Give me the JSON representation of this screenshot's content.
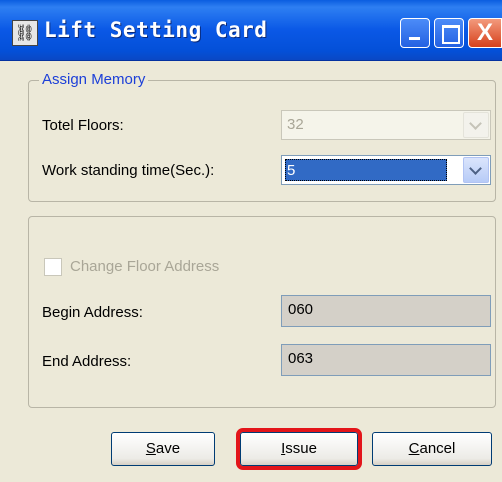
{
  "window": {
    "title": "Lift Setting Card",
    "icon": "lift-app-icon"
  },
  "titlebar_buttons": {
    "minimize_icon": "minimize-icon",
    "maximize_icon": "maximize-icon",
    "close_icon": "close-icon",
    "close_glyph": "X"
  },
  "assign_memory": {
    "legend": "Assign Memory",
    "total_floors_label": "Totel Floors:",
    "total_floors_value": "32",
    "total_floors_enabled": false,
    "standing_time_label": "Work standing time(Sec.):",
    "standing_time_value": "5"
  },
  "address_group": {
    "checkbox_label": "Change Floor Address",
    "checkbox_checked": false,
    "checkbox_enabled": false,
    "begin_label": "Begin Address:",
    "begin_value": "060",
    "end_label": "End Address:",
    "end_value": "063"
  },
  "buttons": {
    "save_accel": "S",
    "save_rest": "ave",
    "issue_accel": "I",
    "issue_rest": "ssue",
    "cancel_accel": "C",
    "cancel_rest": "ancel"
  },
  "colors": {
    "titlebar": "#0a58e6",
    "dialog_bg": "#ece9d8",
    "legend_text": "#1c3fd8",
    "highlight_outline": "#e3151a",
    "selection": "#316ac5"
  }
}
